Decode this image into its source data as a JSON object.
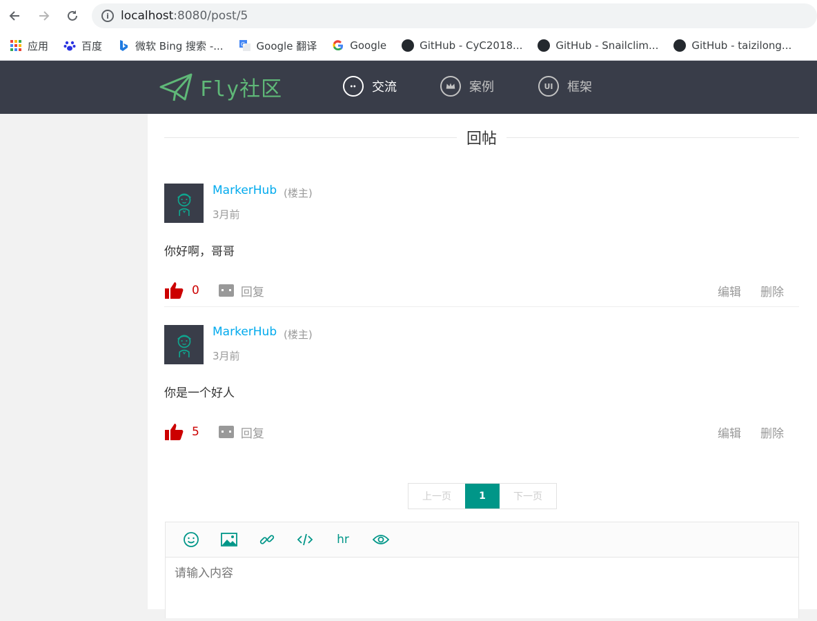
{
  "browser": {
    "url_host": "localhost",
    "url_rest": ":8080/post/5",
    "bookmarks": [
      "应用",
      "百度",
      "微软 Bing 搜索 -...",
      "Google 翻译",
      "Google",
      "GitHub - CyC2018...",
      "GitHub - Snailclim...",
      "GitHub - taizilong..."
    ]
  },
  "header": {
    "logo_text": "Fly社区",
    "menu": [
      "交流",
      "案例",
      "框架"
    ]
  },
  "section": {
    "title": "回帖"
  },
  "replies": [
    {
      "user": "MarkerHub",
      "role": "(楼主)",
      "time": "3月前",
      "content": "你好啊，哥哥",
      "likes": "0",
      "reply": "回复",
      "edit": "编辑",
      "delete": "删除"
    },
    {
      "user": "MarkerHub",
      "role": "(楼主)",
      "time": "3月前",
      "content": "你是一个好人",
      "likes": "5",
      "reply": "回复",
      "edit": "编辑",
      "delete": "删除"
    }
  ],
  "pager": {
    "prev": "上一页",
    "current": "1",
    "next": "下一页"
  },
  "editor": {
    "hr_label": "hr",
    "placeholder": "请输入内容"
  },
  "colors": {
    "accent": "#009688",
    "nav_bg": "#393d49",
    "link": "#01aaed",
    "like": "#cc0000",
    "logo": "#5fb878"
  }
}
